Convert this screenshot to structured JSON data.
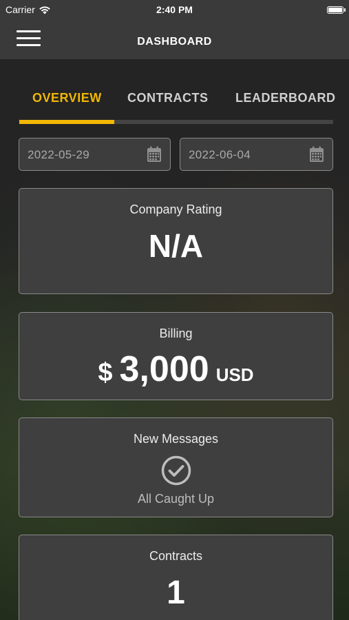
{
  "status_bar": {
    "carrier": "Carrier",
    "time": "2:40 PM"
  },
  "nav": {
    "title": "DASHBOARD"
  },
  "tabs": [
    {
      "label": "OVERVIEW",
      "active": true
    },
    {
      "label": "CONTRACTS",
      "active": false
    },
    {
      "label": "LEADERBOARD",
      "active": false
    }
  ],
  "date_range": {
    "start": "2022-05-29",
    "end": "2022-06-04"
  },
  "cards": {
    "rating": {
      "title": "Company Rating",
      "value": "N/A"
    },
    "billing": {
      "title": "Billing",
      "currency_symbol": "$",
      "amount": "3,000",
      "currency_code": "USD"
    },
    "messages": {
      "title": "New Messages",
      "status": "All Caught Up",
      "icon": "check-circle-icon"
    },
    "contracts": {
      "title": "Contracts",
      "value": "1"
    }
  },
  "colors": {
    "accent": "#f2b705",
    "card_bg": "#3f3f3f",
    "bar_bg": "#3a3a3a"
  }
}
